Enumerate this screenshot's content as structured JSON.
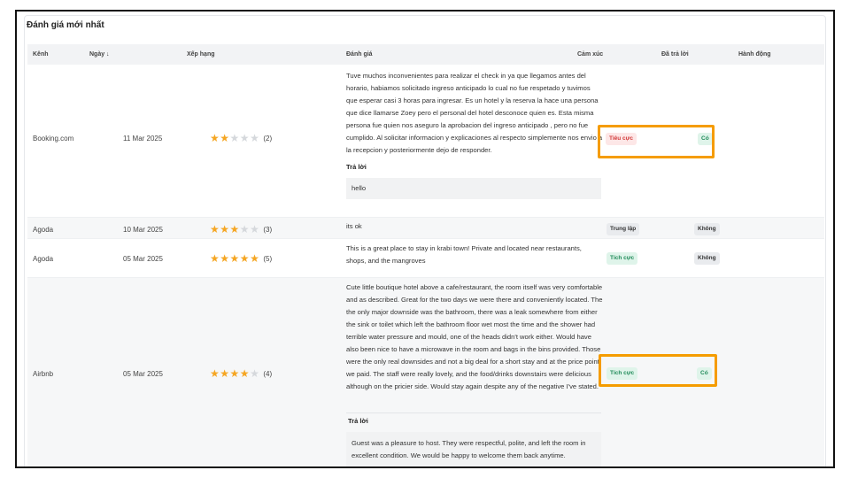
{
  "section_title": "Đánh giá mới nhất",
  "columns": {
    "channel": "Kênh",
    "date": "Ngày ↓",
    "rating": "Xếp hạng",
    "review": "Đánh giá",
    "sentiment": "Cảm xúc",
    "replied": "Đã trả lời",
    "actions": "Hành động"
  },
  "reply_label": "Trả lời",
  "rows": [
    {
      "channel": "Booking.com",
      "date": "11 Mar 2025",
      "rating": 2,
      "rating_text": "(2)",
      "review": "Tuve muchos inconvenientes para realizar el check in ya que llegamos antes del horario, habiamos solicitado ingreso anticipado lo cual no fue respetado y tuvimos que esperar casi 3 horas para ingresar. Es un hotel y la reserva la hace una persona que dice llamarse Zoey pero el personal del hotel desconoce quien es. Esta misma persona fue quien nos aseguro la aprobacion del ingreso anticipado , pero no fue cumplido. Al solicitar informacion y explicaciones al respecto simplemente nos envio a la recepcion y posteriormente dejo de responder.",
      "reply": "hello",
      "sentiment": "Tiêu cực",
      "replied": "Có"
    },
    {
      "channel": "Agoda",
      "date": "10 Mar 2025",
      "rating": 3,
      "rating_text": "(3)",
      "review": "its ok",
      "sentiment": "Trung lập",
      "replied": "Không"
    },
    {
      "channel": "Agoda",
      "date": "05 Mar 2025",
      "rating": 5,
      "rating_text": "(5)",
      "review": "This is a great place to stay in krabi town! Private and located near restaurants, shops, and the mangroves",
      "sentiment": "Tích cực",
      "replied": "Không"
    },
    {
      "channel": "Airbnb",
      "date": "05 Mar 2025",
      "rating": 4,
      "rating_text": "(4)",
      "review": "Cute little boutique hotel above a cafe/restaurant, the room itself was very comfortable and as described. Great for the two days we were there and conveniently located. The the only major downside was the bathroom, there was a leak somewhere from either the sink or toilet which left the bathroom floor wet most the time and the shower had terrible water pressure and mould, one of the heads didn't work either. Would have also been nice to have a microwave in the room and bags in the bins provided. Those were the only real downsides and not a big deal for a short stay and at the price point we paid. The staff were really lovely, and the food/drinks downstairs were delicious although on the pricier side. Would stay again despite any of the negative I've stated.",
      "reply": "Guest was a pleasure to host. They were respectful, polite, and left the room in excellent condition. We would be happy to welcome them back anytime.",
      "sentiment": "Tích cực",
      "replied": "Có"
    }
  ],
  "colors": {
    "highlight": "#f59c00",
    "star_on": "#f5a623",
    "star_off": "#d5d8dc",
    "negative": "#d23b3b",
    "positive": "#1f8a58"
  }
}
